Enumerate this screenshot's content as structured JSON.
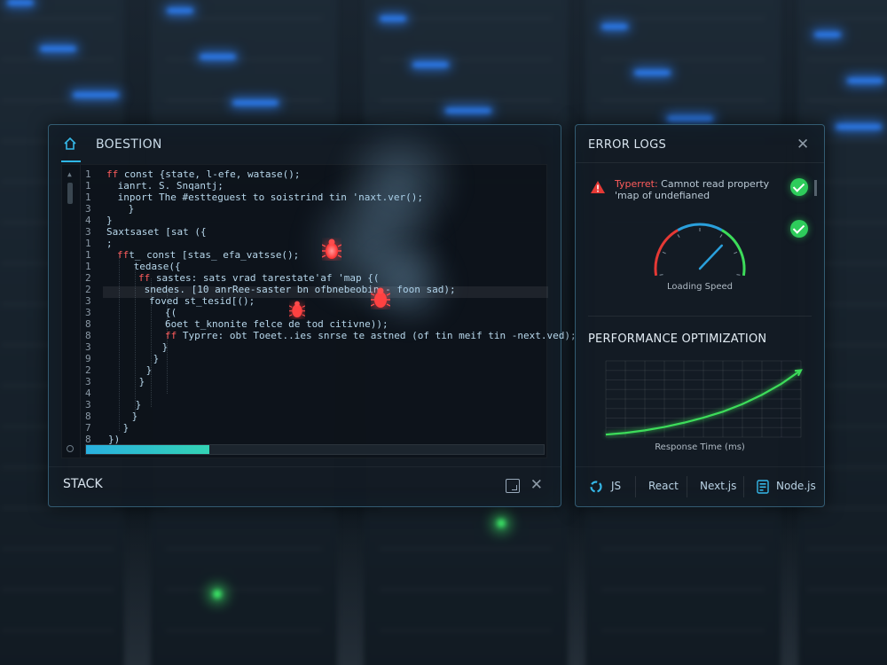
{
  "editor": {
    "title": "BOESTION",
    "footer_label": "STACK",
    "progress": 0.27,
    "lines": [
      {
        "n": "1",
        "kw": "ff",
        "text": " const {state, l-efe, watase();"
      },
      {
        "n": "1",
        "kw": "",
        "text": " ianrt. S. Snqantj;"
      },
      {
        "n": "1",
        "kw": "",
        "text": " inport The #estteguest to soistrind tin 'naxt.ver();"
      },
      {
        "n": "3",
        "kw": "",
        "text": " }"
      },
      {
        "n": "4",
        "kw": "",
        "text": "}"
      },
      {
        "n": "3",
        "kw": "",
        "text": "Saxtsaset [sat ({"
      },
      {
        "n": "1",
        "kw": "",
        "text": ";"
      },
      {
        "n": "1",
        "kw": "ff",
        "text": "t_ const [stas_ efa_vatsse();"
      },
      {
        "n": "1",
        "kw": "",
        "text": " tedase({"
      },
      {
        "n": "2",
        "kw": "ff",
        "text": " sastes: sats vrad tarestate'af 'map {("
      },
      {
        "n": "2",
        "kw": "",
        "text": " snedes. [10 anrRee-saster bn ofbnebeobin - foon sad);"
      },
      {
        "n": "3",
        "kw": "",
        "text": "foved st_tesid[();"
      },
      {
        "n": "3",
        "kw": "",
        "text": "{("
      },
      {
        "n": "8",
        "kw": "",
        "text": "6oet t_knonite felce de tod citivne));"
      },
      {
        "n": "8",
        "kw": "ff",
        "text": " Typrre: obt Toeet..ies snrse te astned (of tin meif tin -next.ved);"
      },
      {
        "n": "3",
        "kw": "",
        "text": " }"
      },
      {
        "n": "9",
        "kw": "",
        "text": " }"
      },
      {
        "n": "2",
        "kw": "",
        "text": " }"
      },
      {
        "n": "3",
        "kw": "",
        "text": " }"
      },
      {
        "n": "4",
        "kw": "",
        "text": ""
      },
      {
        "n": "3",
        "kw": "",
        "text": " }"
      },
      {
        "n": "8",
        "kw": "",
        "text": " }"
      },
      {
        "n": "7",
        "kw": "",
        "text": " }"
      },
      {
        "n": "8",
        "kw": "",
        "text": "})"
      }
    ]
  },
  "error_logs": {
    "title": "ERROR LOGS",
    "error_prefix": "Typerret:",
    "error_message": " Camnot read property 'map of undefianed"
  },
  "gauge": {
    "label": "Loading Speed",
    "level": 0.72,
    "colors": {
      "low": "#e53935",
      "high": "#3ddc5a",
      "mid": "#2aa0dc"
    }
  },
  "performance": {
    "title": "PERFORMANCE OPTIMIZATION",
    "chart_data": {
      "type": "line",
      "xlabel": "Response Time (ms)",
      "ylabel": "",
      "x": [
        0,
        1,
        2,
        3,
        4,
        5,
        6,
        7,
        8,
        9,
        10
      ],
      "series": [
        {
          "values": [
            0.3,
            0.5,
            0.8,
            1.2,
            1.7,
            2.3,
            3.0,
            3.9,
            5.0,
            6.3,
            7.9
          ]
        }
      ],
      "xlim": [
        0,
        10
      ],
      "ylim": [
        0,
        9
      ],
      "grid": true,
      "color": "#3ddc5a"
    }
  },
  "tech_stack": [
    "JS",
    "React",
    "Next.js",
    "Node.js"
  ]
}
